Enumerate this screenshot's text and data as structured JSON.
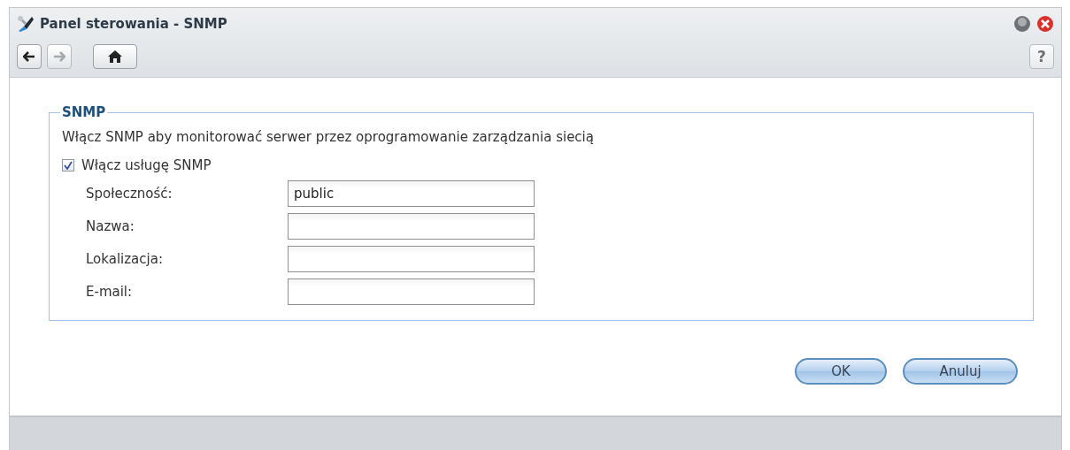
{
  "window": {
    "title": "Panel sterowania - SNMP"
  },
  "toolbar": [
    {
      "kind": "back",
      "disabled": false
    },
    {
      "kind": "forward",
      "disabled": true
    },
    {
      "kind": "home",
      "disabled": false
    }
  ],
  "help": "?",
  "section": {
    "legend": "SNMP",
    "description": "Włącz SNMP aby monitorować serwer przez oprogramowanie zarządzania siecią",
    "enable": {
      "label": "Włącz usługę SNMP",
      "checked": true
    },
    "fields": [
      {
        "label": "Społeczność:",
        "value": "public"
      },
      {
        "label": "Nazwa:"
      },
      {
        "label": "Lokalizacja:"
      },
      {
        "label": "E-mail:"
      }
    ]
  },
  "buttons": [
    "OK",
    "Anuluj"
  ]
}
